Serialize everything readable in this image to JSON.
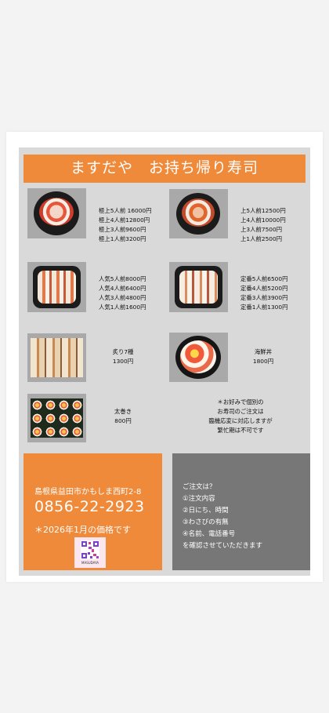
{
  "title": "ますだや　お持ち帰り寿司",
  "menu": {
    "gokujo": [
      "極上5人前 16000円",
      "極上4人前12800円",
      "極上3人前9600円",
      "極上1人前3200円"
    ],
    "jo": [
      "上5人前12500円",
      "上4人前10000円",
      "上3人前7500円",
      "上1人前2500円"
    ],
    "ninki": [
      "人気5人前8000円",
      "人気4人前6400円",
      "人気3人前4800円",
      "人気1人前1600円"
    ],
    "teiban": [
      "定番5人前6500円",
      "定番4人前5200円",
      "定番3人前3900円",
      "定番1人前1300円"
    ],
    "aburi": [
      "炙り7種",
      "1300円"
    ],
    "kaisendon": [
      "海鮮丼",
      "1800円"
    ],
    "futomaki": [
      "太巻き",
      "800円"
    ],
    "note": [
      "＊お好みで個別の",
      "お寿司のご注文は",
      "臨機応変に対応しますが",
      "繁忙期は不可です"
    ]
  },
  "contact": {
    "address": "島根県益田市かもしま西町2-8",
    "phone": "0856-22-2923",
    "price_note": "＊2026年1月の価格です",
    "qr_caption": "MASUDAYA"
  },
  "order": {
    "heading": "ご注文は？",
    "items": [
      "①注文内容",
      "②日にち、時間",
      "③わさびの有無",
      "④名前、電話番号"
    ],
    "closing": "を確認させていただきます"
  },
  "colors": {
    "accent": "#ef8a3a",
    "panel": "#d9d9d9",
    "gray_box": "#777777",
    "photo_frame": "#a9a9a9"
  }
}
